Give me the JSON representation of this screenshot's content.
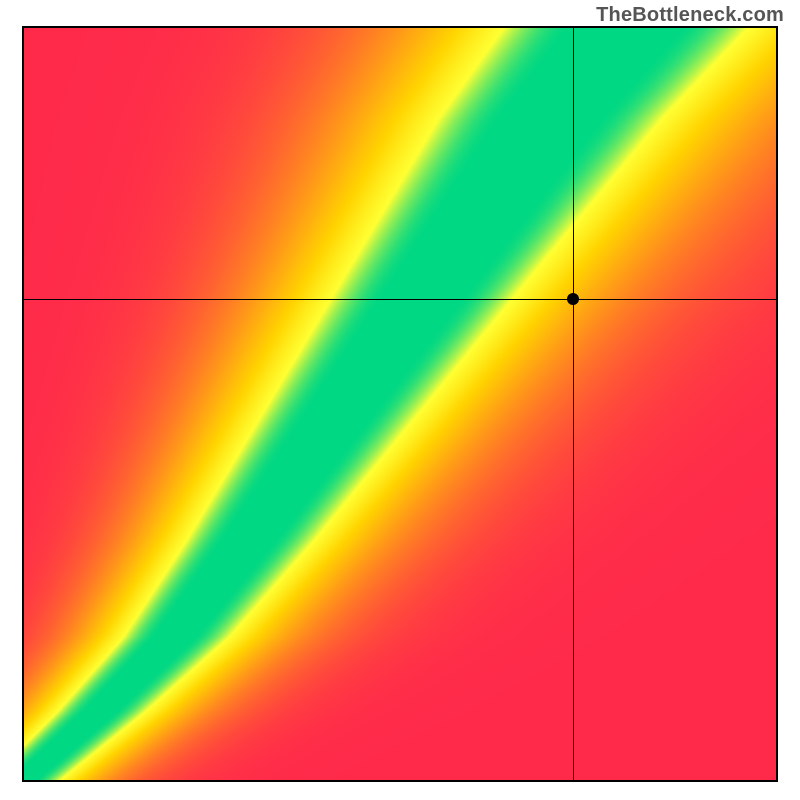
{
  "watermark": "TheBottleneck.com",
  "chart_data": {
    "type": "heatmap",
    "title": "",
    "xlabel": "",
    "ylabel": "",
    "xlim": [
      0,
      1
    ],
    "ylim": [
      0,
      1
    ],
    "grid": false,
    "legend": false,
    "colorscale": [
      {
        "stop": 0.0,
        "color": "#ff2a4a"
      },
      {
        "stop": 0.4,
        "color": "#ff8a1f"
      },
      {
        "stop": 0.7,
        "color": "#ffd400"
      },
      {
        "stop": 0.88,
        "color": "#ffff33"
      },
      {
        "stop": 1.0,
        "color": "#00d884"
      }
    ],
    "optimal_curve": {
      "description": "Green ridge of optimal balance; y ≈ f(x), monotone increasing, slightly super-linear after midrange",
      "points": [
        {
          "x": 0.0,
          "y": 0.0
        },
        {
          "x": 0.1,
          "y": 0.09
        },
        {
          "x": 0.2,
          "y": 0.19
        },
        {
          "x": 0.3,
          "y": 0.32
        },
        {
          "x": 0.4,
          "y": 0.46
        },
        {
          "x": 0.5,
          "y": 0.6
        },
        {
          "x": 0.6,
          "y": 0.74
        },
        {
          "x": 0.7,
          "y": 0.88
        },
        {
          "x": 0.8,
          "y": 1.0
        }
      ],
      "band_halfwidth_x": 0.035
    },
    "crosshair": {
      "x": 0.73,
      "y": 0.64
    },
    "marker": {
      "x": 0.73,
      "y": 0.64
    }
  }
}
